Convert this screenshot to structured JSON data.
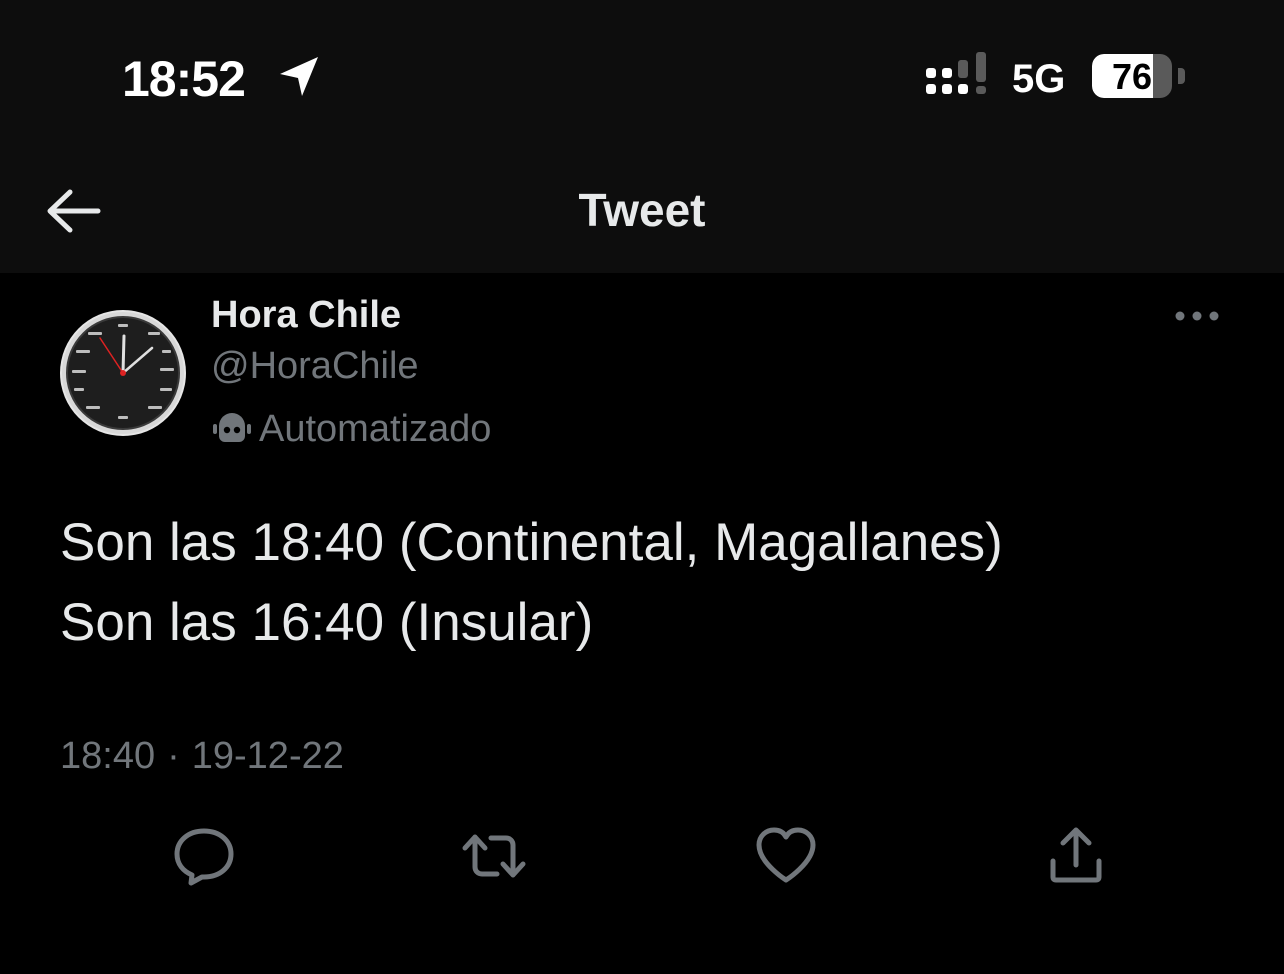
{
  "status_bar": {
    "time": "18:52",
    "network": "5G",
    "battery_level": 76,
    "battery_label": "76"
  },
  "header": {
    "title": "Tweet",
    "back_icon": "arrow-left-icon"
  },
  "tweet": {
    "author": {
      "display_name": "Hora Chile",
      "handle": "@HoraChile",
      "label": "Automatizado",
      "avatar_icon": "math-clock-avatar"
    },
    "text_lines": [
      "Son las 18:40 (Continental, Magallanes)",
      "Son las 16:40 (Insular)"
    ],
    "time": "18:40",
    "separator": "·",
    "date": "19-12-22"
  },
  "actions": [
    "reply-icon",
    "retweet-icon",
    "like-icon",
    "share-icon"
  ],
  "colors": {
    "background": "#000000",
    "bar_background": "#0d0d0d",
    "primary_text": "#e7e9ea",
    "secondary_text": "#71767b"
  }
}
